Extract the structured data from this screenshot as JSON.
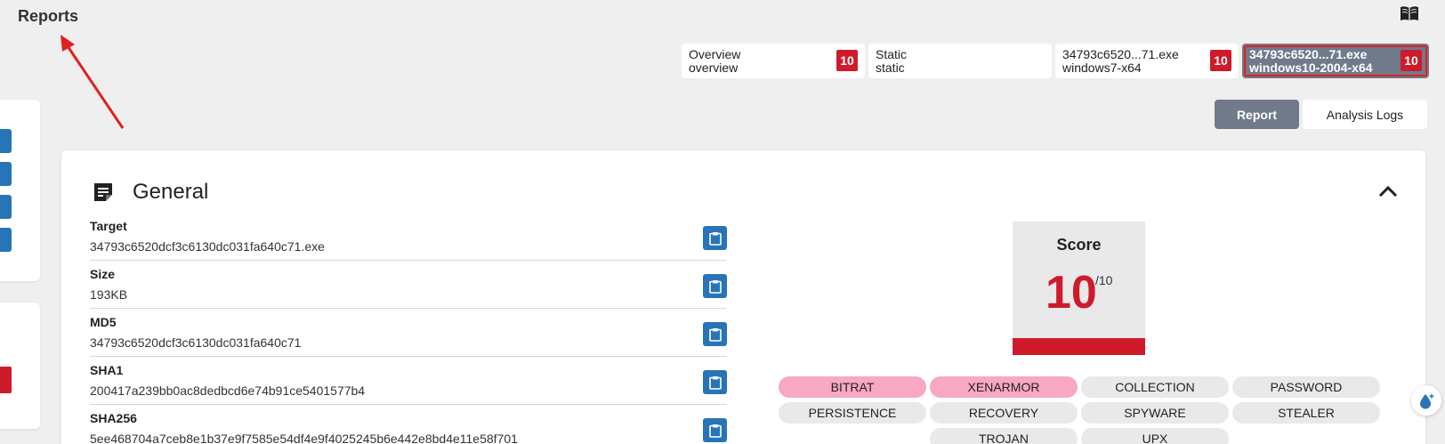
{
  "header": {
    "title": "Reports",
    "docs_icon": "book-icon"
  },
  "tabs": [
    {
      "line1": "Overview",
      "line2": "overview",
      "score": "10",
      "active": false
    },
    {
      "line1": "Static",
      "line2": "static",
      "score": "",
      "active": false
    },
    {
      "line1": "34793c6520...71.exe",
      "line2": "windows7-x64",
      "score": "10",
      "active": false
    },
    {
      "line1": "34793c6520...71.exe",
      "line2": "windows10-2004-x64",
      "score": "10",
      "active": true
    }
  ],
  "view_toggle": {
    "report_label": "Report",
    "logs_label": "Analysis Logs"
  },
  "general": {
    "title": "General",
    "fields": [
      {
        "label": "Target",
        "value": "34793c6520dcf3c6130dc031fa640c71.exe"
      },
      {
        "label": "Size",
        "value": "193KB"
      },
      {
        "label": "MD5",
        "value": "34793c6520dcf3c6130dc031fa640c71"
      },
      {
        "label": "SHA1",
        "value": "200417a239bb0ac8dedbcd6e74b91ce5401577b4"
      },
      {
        "label": "SHA256",
        "value": "5ee468704a7ceb8e1b37e9f7585e54df4e9f4025245b6e442e8bd4e11e58f701"
      }
    ],
    "score": {
      "label": "Score",
      "value": "10",
      "max": "/10",
      "fraction": 1.0
    },
    "tags": [
      {
        "label": "BITRAT",
        "highlight": true
      },
      {
        "label": "XENARMOR",
        "highlight": true
      },
      {
        "label": "COLLECTION",
        "highlight": false
      },
      {
        "label": "PASSWORD",
        "highlight": false
      },
      {
        "label": "PERSISTENCE",
        "highlight": false
      },
      {
        "label": "RECOVERY",
        "highlight": false
      },
      {
        "label": "SPYWARE",
        "highlight": false
      },
      {
        "label": "STEALER",
        "highlight": false
      },
      {
        "label": "",
        "highlight": false,
        "empty": true
      },
      {
        "label": "TROJAN",
        "highlight": false
      },
      {
        "label": "UPX",
        "highlight": false
      }
    ]
  },
  "colors": {
    "accent": "#cf1a2c",
    "button_blue": "#2874b8",
    "active_tab": "#707a8a",
    "tag_highlight": "#f8a8c2"
  }
}
